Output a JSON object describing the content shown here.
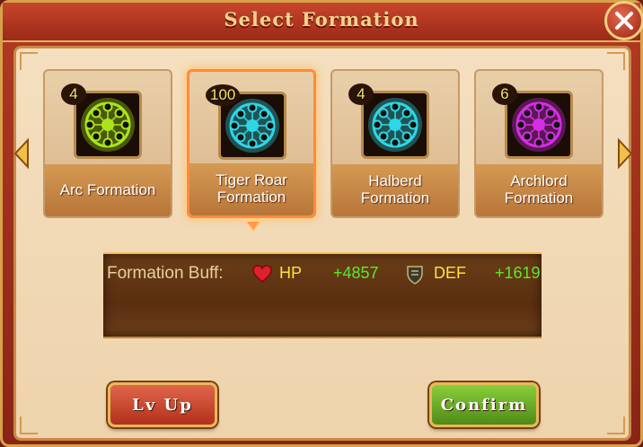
{
  "dialog": {
    "title": "Select Formation"
  },
  "formations": [
    {
      "name": "Arc Formation",
      "level": "4",
      "color": "#a8e61a",
      "selected": false
    },
    {
      "name": "Tiger Roar Formation",
      "level": "100",
      "color": "#2ed6e6",
      "selected": true
    },
    {
      "name": "Halberd Formation",
      "level": "4",
      "color": "#2ed6e6",
      "selected": false
    },
    {
      "name": "Archlord Formation",
      "level": "6",
      "color": "#d42ee6",
      "selected": false
    }
  ],
  "buff": {
    "label": "Formation Buff:",
    "stats": [
      {
        "icon": "heart-icon",
        "name": "HP",
        "value": "+4857"
      },
      {
        "icon": "shield-icon",
        "name": "DEF",
        "value": "+1619"
      }
    ]
  },
  "buttons": {
    "lvup": "Lv Up",
    "confirm": "Confirm"
  },
  "colors": {
    "accent_gold": "#f3d38c",
    "stat_name": "#ffe23a",
    "stat_value": "#5bea2a",
    "selected_border": "#ff8a3d"
  }
}
